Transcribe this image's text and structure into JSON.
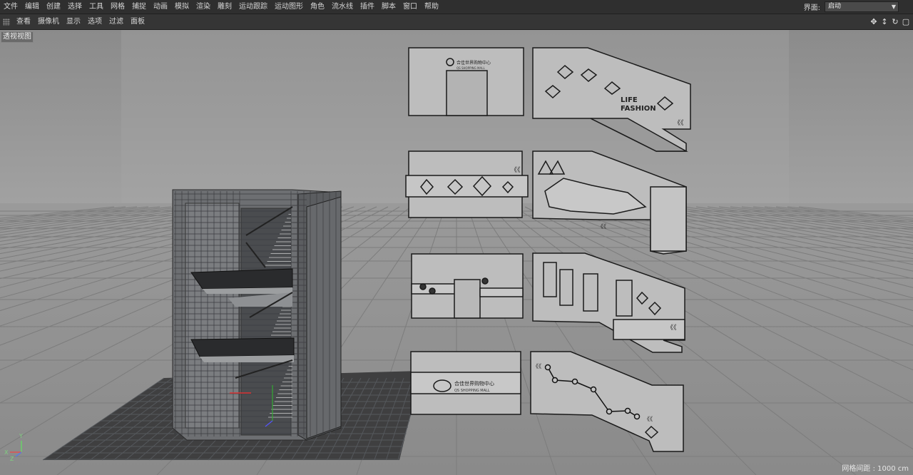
{
  "menu": [
    "文件",
    "编辑",
    "创建",
    "选择",
    "工具",
    "网格",
    "捕捉",
    "动画",
    "模拟",
    "渲染",
    "雕刻",
    "运动跟踪",
    "运动图形",
    "角色",
    "流水线",
    "插件",
    "脚本",
    "窗口",
    "帮助"
  ],
  "layout": {
    "label": "界面:",
    "value": "启动"
  },
  "toolbar": [
    "查看",
    "摄像机",
    "显示",
    "选项",
    "过滤",
    "面板"
  ],
  "viewport": {
    "name": "透视视图",
    "grid_spacing": "网格间距 : 1000 cm"
  },
  "axes": {
    "y": "Y",
    "x": "X",
    "z": "Z"
  },
  "models": {
    "brand_top": "合佳世界购物中心",
    "brand_sub": "QS SHOPPING MALL",
    "life_fashion_1": "LIFE",
    "life_fashion_2": "FASHION",
    "chevrons": "《《"
  }
}
